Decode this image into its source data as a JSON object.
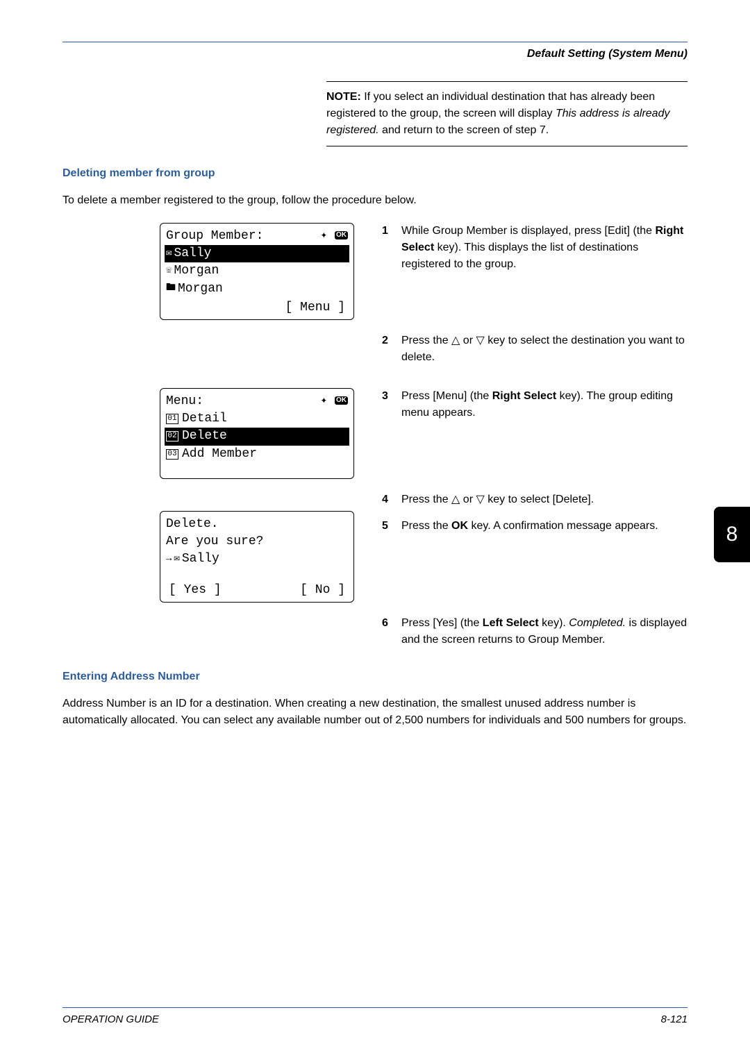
{
  "breadcrumb": "Default Setting (System Menu)",
  "note": {
    "label": "NOTE:",
    "part1": " If you select an individual destination that has already been registered to the group, the screen will display ",
    "italic": "This address is already registered.",
    "part2": " and return to the screen of step 7."
  },
  "section1": {
    "heading": "Deleting member from group",
    "intro": "To delete a member registered to the group, follow the procedure below."
  },
  "lcd1": {
    "title": "Group Member:",
    "item1": "Sally",
    "item2": "Morgan",
    "item3": "Morgan",
    "menu": "Menu"
  },
  "lcd2": {
    "title": "Menu:",
    "item1": "Detail",
    "item2": "Delete",
    "item3": "Add Member"
  },
  "lcd3": {
    "line1": "Delete.",
    "line2": "Are you sure?",
    "line3": "Sally",
    "yes": "Yes",
    "no": "No"
  },
  "steps": {
    "s1_a": "While Group Member is displayed, press [Edit] (the ",
    "s1_b": "Right Select",
    "s1_c": " key). This displays the list of destinations registered to the group.",
    "s2_a": "Press the ",
    "s2_b": " or ",
    "s2_c": " key to select the destination you want to delete.",
    "s3_a": "Press [Menu] (the ",
    "s3_b": "Right Select",
    "s3_c": " key). The group editing menu appears.",
    "s4_a": "Press the ",
    "s4_b": " or ",
    "s4_c": " key to select [Delete].",
    "s5_a": "Press the ",
    "s5_b": "OK",
    "s5_c": " key. A confirmation message appears.",
    "s6_a": "Press [Yes] (the ",
    "s6_b": "Left Select",
    "s6_c": " key). ",
    "s6_d": "Completed.",
    "s6_e": " is displayed and the screen returns to Group Member."
  },
  "section2": {
    "heading": "Entering Address Number",
    "body": "Address Number is an ID for a destination. When creating a new destination, the smallest unused address number is automatically allocated. You can select any available number out of 2,500 numbers for individuals and 500 numbers for groups."
  },
  "footer": {
    "left": "OPERATION GUIDE",
    "right": "8-121"
  },
  "chapter": "8"
}
